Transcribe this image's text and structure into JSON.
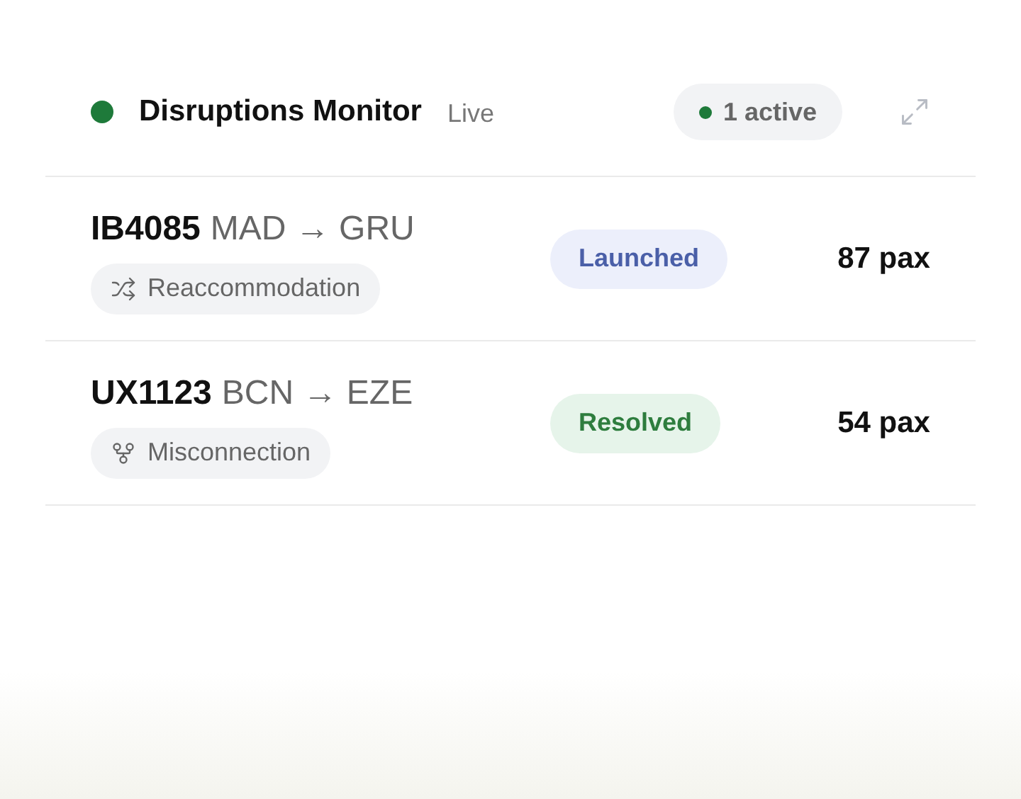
{
  "header": {
    "title": "Disruptions Monitor",
    "live_label": "Live",
    "live": true,
    "active_badge": "1 active"
  },
  "disruptions": [
    {
      "flight": "IB4085",
      "route": "MAD → GRU",
      "category": {
        "kind": "reaccommodation",
        "label": "Reaccommodation"
      },
      "status": {
        "kind": "launched",
        "label": "Launched"
      },
      "pax": "87 pax"
    },
    {
      "flight": "UX1123",
      "route": "BCN → EZE",
      "category": {
        "kind": "misconnection",
        "label": "Misconnection"
      },
      "status": {
        "kind": "resolved",
        "label": "Resolved"
      },
      "pax": "54 pax"
    }
  ]
}
